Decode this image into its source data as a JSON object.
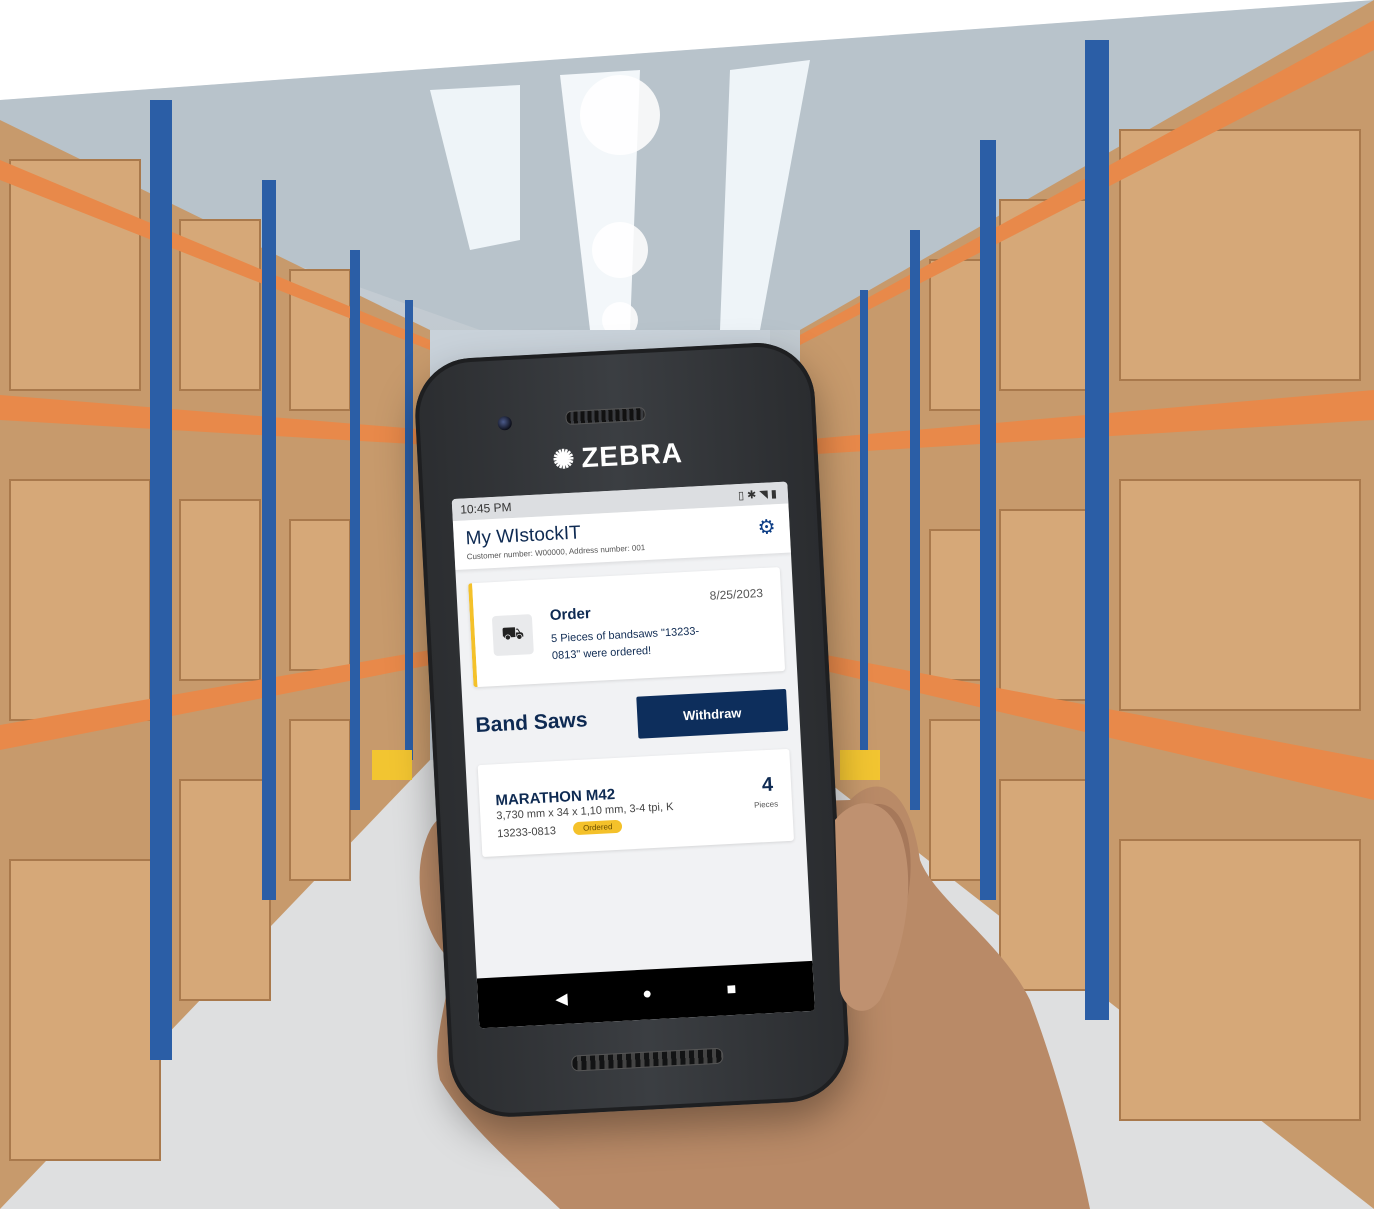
{
  "device": {
    "brand": "ZEBRA",
    "brand_icon": "zebra-logo-icon"
  },
  "status_bar": {
    "time": "10:45 PM",
    "icons": "vibrate-icon bluetooth-icon wifi-icon battery-icon"
  },
  "app": {
    "title": "My WIstockIT",
    "subtitle": "Customer number: W00000, Address number: 001",
    "settings_icon": "gear-icon"
  },
  "order_card": {
    "title": "Order",
    "date": "8/25/2023",
    "message": "5 Pieces of bandsaws \"13233-0813\" were ordered!",
    "icon": "truck-icon",
    "accent": "#f4c12a"
  },
  "section": {
    "title": "Band Saws",
    "withdraw_label": "Withdraw"
  },
  "item": {
    "name": "MARATHON M42",
    "spec": "3,730 mm x 34 x 1,10 mm, 3-4 tpi, K",
    "code": "13233-0813",
    "status": "Ordered",
    "quantity": "4",
    "unit": "Pieces"
  },
  "nav": {
    "back": "◀",
    "home": "●",
    "recent": "■"
  },
  "colors": {
    "primary": "#0d2e5c",
    "accent": "#f4c12a",
    "shelf_orange": "#e8894a",
    "shelf_blue": "#2b5ea6"
  }
}
